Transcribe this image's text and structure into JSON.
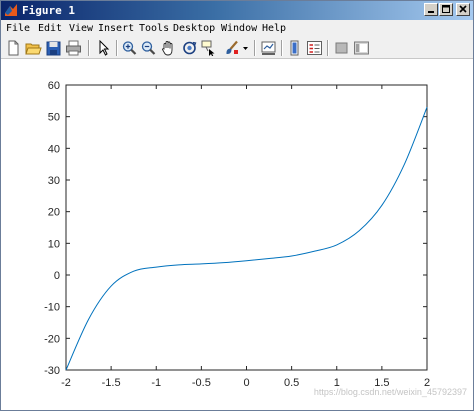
{
  "window": {
    "title": "Figure 1"
  },
  "menu": {
    "items": [
      "File",
      "Edit",
      "View",
      "Insert",
      "Tools",
      "Desktop",
      "Window",
      "Help"
    ]
  },
  "toolbar": {
    "icons": [
      "new-figure-icon",
      "open-file-icon",
      "save-figure-icon",
      "print-figure-icon",
      "edit-plot-arrow-icon",
      "zoom-in-icon",
      "zoom-out-icon",
      "pan-hand-icon",
      "rotate-3d-icon",
      "data-cursor-icon",
      "brush-icon",
      "brush-dropdown-icon",
      "link-plot-icon",
      "insert-colorbar-icon",
      "insert-legend-icon",
      "hide-plot-tools-icon",
      "show-plot-tools-icon"
    ]
  },
  "watermark": "https://blog.csdn.net/weixin_45792397",
  "chart_data": {
    "type": "line",
    "title": "",
    "xlabel": "",
    "ylabel": "",
    "xlim": [
      -2,
      2
    ],
    "ylim": [
      -30,
      60
    ],
    "xticks": [
      -2,
      -1.5,
      -1,
      -0.5,
      0,
      0.5,
      1,
      1.5,
      2
    ],
    "xtick_labels": [
      "-2",
      "-1.5",
      "-1",
      "-0.5",
      "0",
      "0.5",
      "1",
      "1.5",
      "2"
    ],
    "yticks": [
      -30,
      -20,
      -10,
      0,
      10,
      20,
      30,
      40,
      50,
      60
    ],
    "ytick_labels": [
      "-30",
      "-20",
      "-10",
      "0",
      "10",
      "20",
      "30",
      "40",
      "50",
      "60"
    ],
    "grid": false,
    "color": "#0072bd",
    "series": [
      {
        "x": [
          -2,
          -1.75,
          -1.5,
          -1.25,
          -1,
          -0.75,
          -0.5,
          -0.25,
          0,
          0.25,
          0.5,
          0.75,
          1,
          1.25,
          1.5,
          1.75,
          2
        ],
        "y": [
          -30,
          -14,
          -3.5,
          1.2,
          2.5,
          3.2,
          3.5,
          3.9,
          4.5,
          5.2,
          6,
          7.5,
          9.5,
          14,
          22,
          35,
          53
        ]
      }
    ]
  }
}
